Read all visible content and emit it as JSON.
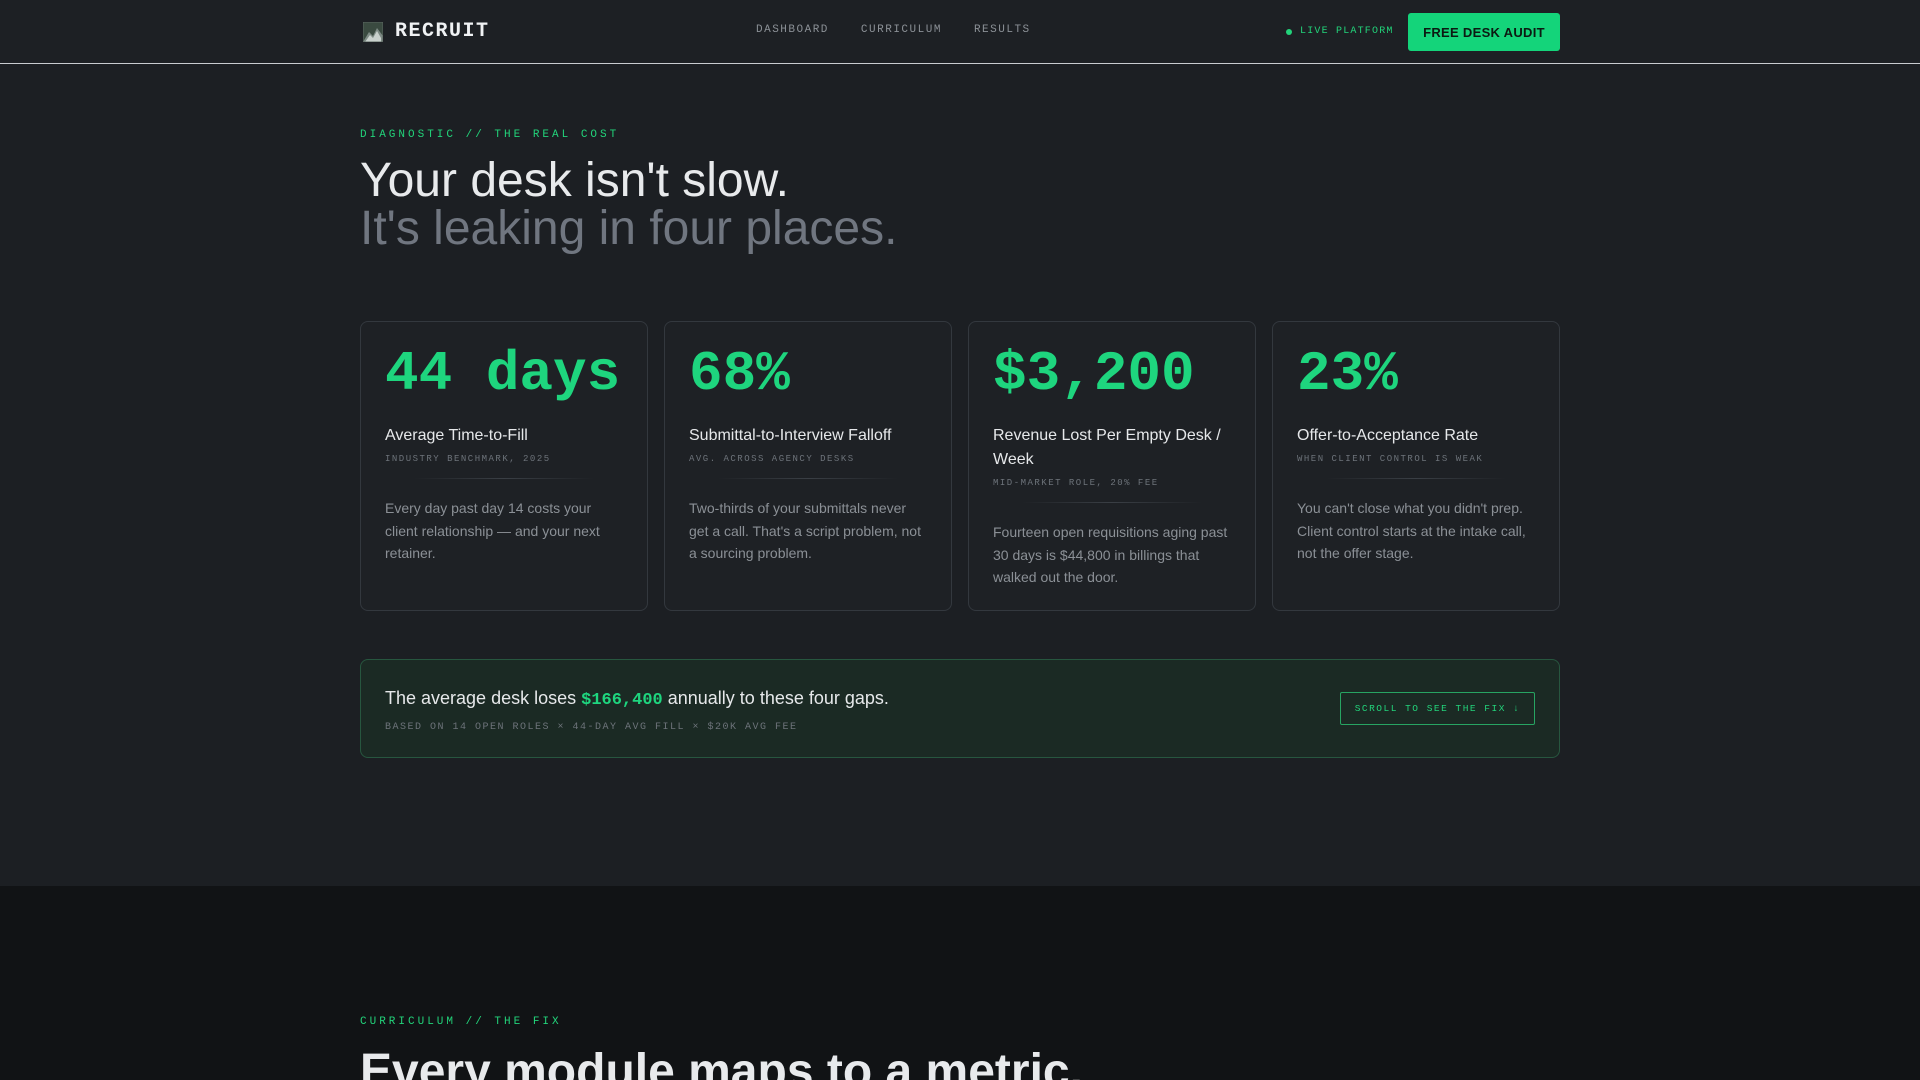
{
  "nav": {
    "brand": "RECRUIT",
    "links": [
      "DASHBOARD",
      "CURRICULUM",
      "RESULTS"
    ],
    "live_label": "LIVE PLATFORM",
    "cta_label": "FREE DESK AUDIT"
  },
  "hero": {
    "eyebrow": "DIAGNOSTIC // THE REAL COST",
    "headline_1": "Your desk isn't slow.",
    "headline_2": "It's leaking in four places."
  },
  "cards": [
    {
      "stat": "44 days",
      "title": "Average Time-to-Fill",
      "sub": "INDUSTRY BENCHMARK, 2025",
      "body": "Every day past day 14 costs your client relationship — and your next retainer."
    },
    {
      "stat": "68%",
      "title": "Submittal-to-Interview Falloff",
      "sub": "AVG. ACROSS AGENCY DESKS",
      "body": "Two-thirds of your submittals never get a call. That's a script problem, not a sourcing problem."
    },
    {
      "stat": "$3,200",
      "title": "Revenue Lost Per Empty Desk / Week",
      "sub": "MID-MARKET ROLE, 20% FEE",
      "body": "Fourteen open requisitions aging past 30 days is $44,800 in billings that walked out the door."
    },
    {
      "stat": "23%",
      "title": "Offer-to-Acceptance Rate",
      "sub": "WHEN CLIENT CONTROL IS WEAK",
      "body": "You can't close what you didn't prep. Client control starts at the intake call, not the offer stage."
    }
  ],
  "banner": {
    "text_before": "The average desk loses ",
    "amount": "$166,400",
    "text_after": " annually to these four gaps.",
    "sub": "BASED ON 14 OPEN ROLES × 44-DAY AVG FILL × $20K AVG FEE",
    "button": "SCROLL TO SEE THE FIX ↓"
  },
  "section2": {
    "eyebrow": "CURRICULUM // THE FIX",
    "headline": "Every module maps to a metric."
  },
  "colors": {
    "accent": "#1ed57e",
    "background": "#1c1f23",
    "section2_bg": "#111315"
  }
}
